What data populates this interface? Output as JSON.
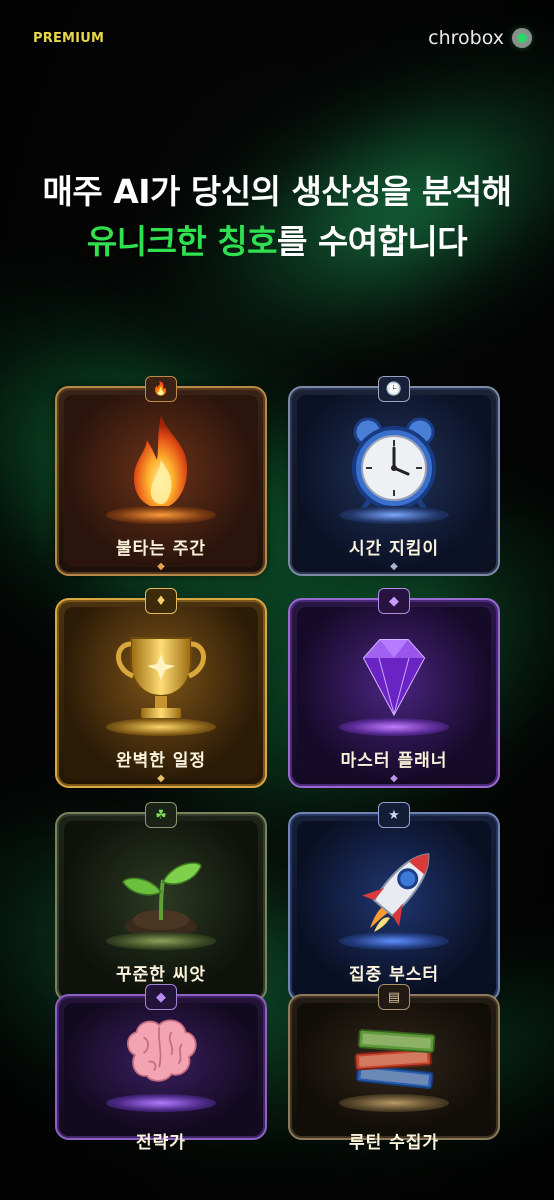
{
  "header": {
    "premium_label": "PREMIUM",
    "brand_name": "chrobox",
    "brand_logo_icon": "chrobox-logo-icon"
  },
  "headline": {
    "line1": "매주 AI가 당신의 생산성을 분석해",
    "line2_highlight": "유니크한 칭호",
    "line2_rest": "를 수여합니다",
    "highlight_color": "#2fe14f"
  },
  "badges": [
    {
      "label": "불타는 주간",
      "icon": "flame-icon",
      "emblem_icon": "flame-emblem-icon"
    },
    {
      "label": "시간 지킴이",
      "icon": "alarm-clock-icon",
      "emblem_icon": "clock-emblem-icon"
    },
    {
      "label": "완벽한 일정",
      "icon": "trophy-icon",
      "emblem_icon": "crown-emblem-icon"
    },
    {
      "label": "마스터 플래너",
      "icon": "diamond-icon",
      "emblem_icon": "gem-emblem-icon"
    },
    {
      "label": "꾸준한 씨앗",
      "icon": "sprout-icon",
      "emblem_icon": "leaf-emblem-icon"
    },
    {
      "label": "집중 부스터",
      "icon": "rocket-icon",
      "emblem_icon": "star-emblem-icon"
    },
    {
      "label": "전략가",
      "icon": "brain-icon",
      "emblem_icon": "gem-emblem-icon"
    },
    {
      "label": "루틴 수집가",
      "icon": "books-icon",
      "emblem_icon": "book-emblem-icon"
    }
  ]
}
